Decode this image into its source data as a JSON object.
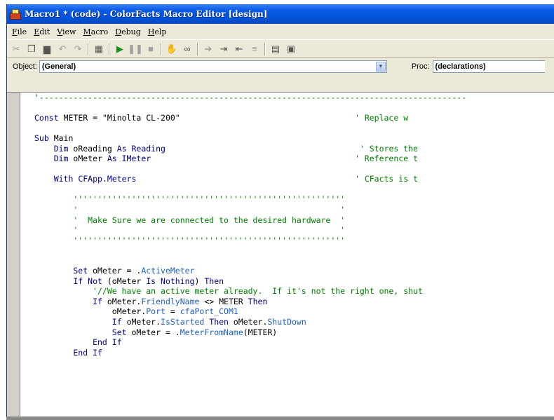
{
  "window": {
    "title": "Macro1 * (code) - ColorFacts Macro Editor [design]"
  },
  "menu": [
    {
      "u": "F",
      "rest": "ile"
    },
    {
      "u": "E",
      "rest": "dit"
    },
    {
      "u": "V",
      "rest": "iew"
    },
    {
      "u": "M",
      "rest": "acro"
    },
    {
      "u": "D",
      "rest": "ebug"
    },
    {
      "u": "H",
      "rest": "elp"
    }
  ],
  "object_bar": {
    "object_label": "Object:",
    "object_value": "(General)",
    "proc_label": "Proc:",
    "proc_value": "(declarations)"
  },
  "code_lines": [
    [
      {
        "t": "'----------------------------------------------------------------------------------------",
        "c": "cm"
      }
    ],
    [],
    [
      {
        "t": "Const ",
        "c": "kw"
      },
      {
        "t": "METER = \"Minolta CL-200\"",
        "c": "tx"
      },
      {
        "t": "                                    ' Replace w",
        "c": "cm"
      }
    ],
    [],
    [
      {
        "t": "Sub ",
        "c": "kw"
      },
      {
        "t": "Main",
        "c": "tx"
      }
    ],
    [
      {
        "t": "    Dim ",
        "c": "kw"
      },
      {
        "t": "oReading ",
        "c": "tx"
      },
      {
        "t": "As Reading",
        "c": "kw"
      },
      {
        "t": "                                        ' Stores the",
        "c": "cm"
      }
    ],
    [
      {
        "t": "    Dim ",
        "c": "kw"
      },
      {
        "t": "oMeter ",
        "c": "tx"
      },
      {
        "t": "As IMeter",
        "c": "kw"
      },
      {
        "t": "                                          ' Reference t",
        "c": "cm"
      }
    ],
    [],
    [
      {
        "t": "    With ",
        "c": "kw"
      },
      {
        "t": "CFApp.Meters",
        "c": "kw"
      },
      {
        "t": "                                             ' CFacts is t",
        "c": "cm"
      }
    ],
    [],
    [
      {
        "t": "        ''''''''''''''''''''''''''''''''''''''''''''''''''''''''",
        "c": "cm"
      }
    ],
    [
      {
        "t": "        '                                                      '",
        "c": "cm"
      }
    ],
    [
      {
        "t": "        '  Make Sure we are connected to the desired hardware  '",
        "c": "cm"
      }
    ],
    [
      {
        "t": "        '                                                      '",
        "c": "cm"
      }
    ],
    [
      {
        "t": "        ''''''''''''''''''''''''''''''''''''''''''''''''''''''''",
        "c": "cm"
      }
    ],
    [],
    [],
    [
      {
        "t": "        Set ",
        "c": "kw"
      },
      {
        "t": "oMeter = .",
        "c": "tx"
      },
      {
        "t": "ActiveMeter",
        "c": "pr"
      }
    ],
    [
      {
        "t": "        If Not ",
        "c": "kw"
      },
      {
        "t": "(oMeter ",
        "c": "tx"
      },
      {
        "t": "Is Nothing",
        "c": "kw"
      },
      {
        "t": ") ",
        "c": "tx"
      },
      {
        "t": "Then",
        "c": "kw"
      }
    ],
    [
      {
        "t": "            '//We have an active meter already.  If it's not the right one, shut",
        "c": "cm"
      }
    ],
    [
      {
        "t": "            If ",
        "c": "kw"
      },
      {
        "t": "oMeter.",
        "c": "tx"
      },
      {
        "t": "FriendlyName",
        "c": "pr"
      },
      {
        "t": " <> METER ",
        "c": "tx"
      },
      {
        "t": "Then",
        "c": "kw"
      }
    ],
    [
      {
        "t": "                oMeter.",
        "c": "tx"
      },
      {
        "t": "Port",
        "c": "pr"
      },
      {
        "t": " = ",
        "c": "tx"
      },
      {
        "t": "cfaPort_COM1",
        "c": "pr"
      }
    ],
    [
      {
        "t": "                If ",
        "c": "kw"
      },
      {
        "t": "oMeter.",
        "c": "tx"
      },
      {
        "t": "IsStarted ",
        "c": "pr"
      },
      {
        "t": "Then ",
        "c": "kw"
      },
      {
        "t": "oMeter.",
        "c": "tx"
      },
      {
        "t": "ShutDown",
        "c": "pr"
      }
    ],
    [
      {
        "t": "                Set ",
        "c": "kw"
      },
      {
        "t": "oMeter = .",
        "c": "tx"
      },
      {
        "t": "MeterFromName",
        "c": "pr"
      },
      {
        "t": "(METER)",
        "c": "tx"
      }
    ],
    [
      {
        "t": "            End If",
        "c": "kw"
      }
    ],
    [
      {
        "t": "        End If",
        "c": "kw"
      }
    ]
  ],
  "colors": {
    "keyword": "#00008b",
    "comment": "#008000",
    "property": "#2060c0",
    "titlebar": "#0a5ce8"
  }
}
